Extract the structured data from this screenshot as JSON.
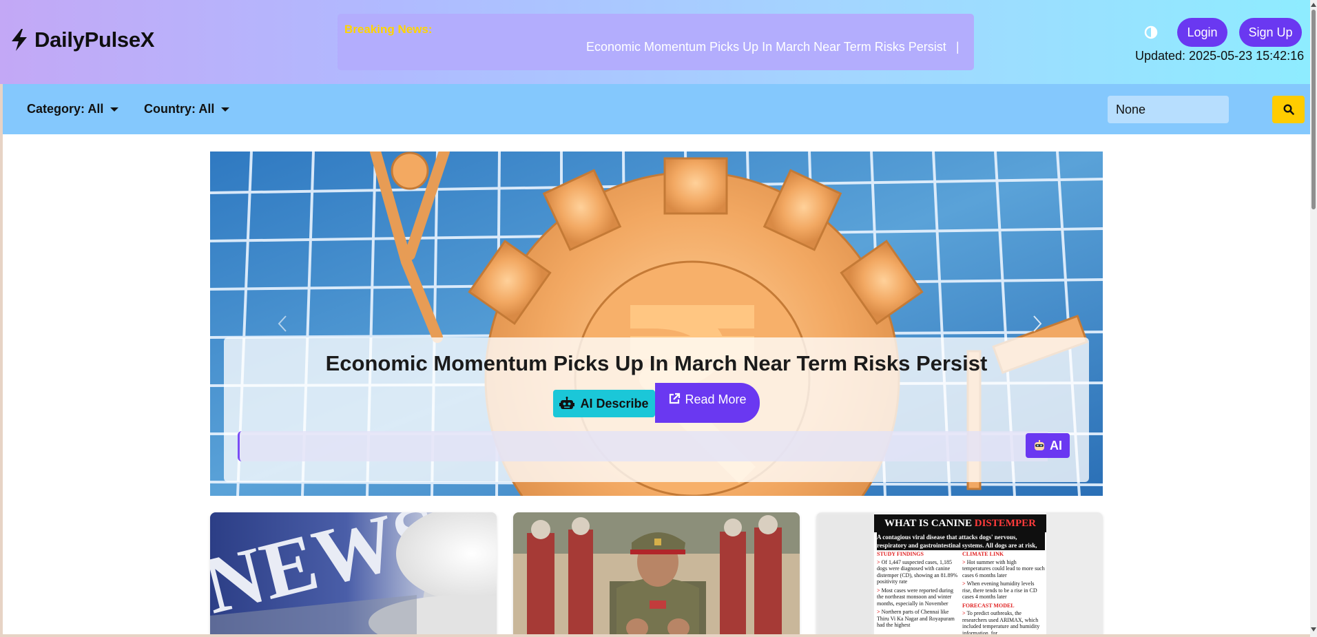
{
  "header": {
    "brand": "DailyPulseX",
    "breaking_label": "Breaking News:",
    "ticker_text": "Economic Momentum Picks Up In March Near Term Risks Persist",
    "ticker_separator": "|",
    "theme_toggle_icon": "contrast-icon",
    "login_label": "Login",
    "signup_label": "Sign Up",
    "updated_text": "Updated: 2025-05-23 15:42:16"
  },
  "filters": {
    "category_label": "Category: All",
    "country_label": "Country: All",
    "search_value": "None",
    "search_icon": "search-icon"
  },
  "hero": {
    "title": "Economic Momentum Picks Up In March Near Term Risks Persist",
    "ai_describe_label": "AI Describe",
    "read_more_label": "Read More",
    "ai_input_value": "",
    "ai_button_label": "AI"
  },
  "cards": {
    "card1_word": "NEWS",
    "infographic": {
      "title_part1": "WHAT IS CANINE ",
      "title_part2": "DISTEMPER (CD)?",
      "subtitle": "A contagious viral disease that attacks dogs' nervous, respiratory and gastrointestinal systems. All dogs are at risk, mostly puppies",
      "left_head": "STUDY FINDINGS",
      "left_items": [
        "Of 1,447 suspected cases, 1,185 dogs were diagnosed with canine distemper (CD), showing an 81.89% positivity rate",
        "Most cases were reported during the northeast monsoon and winter months, especially in November",
        "Northern parts of Chennai like Thiru Vi Ka Nagar and Royapuram had the highest"
      ],
      "right_head": "CLIMATE LINK",
      "right_items": [
        "Hot summer with high temperatures could lead to more such cases 6 months later",
        "When evening humidity levels rise, there tends to be a rise in CD cases 4 months later"
      ],
      "right_head2": "FORECAST MODEL",
      "right_items2": [
        "To predict outbreaks, the researchers used ARIMAX, which included temperature and humidity information, for"
      ]
    }
  },
  "colors": {
    "accent_purple": "#6a38f1",
    "filter_bar": "#84c8fd",
    "breaking_yellow": "#ffd400",
    "search_button": "#ffcc00",
    "ai_describe": "#1bc7d8"
  }
}
